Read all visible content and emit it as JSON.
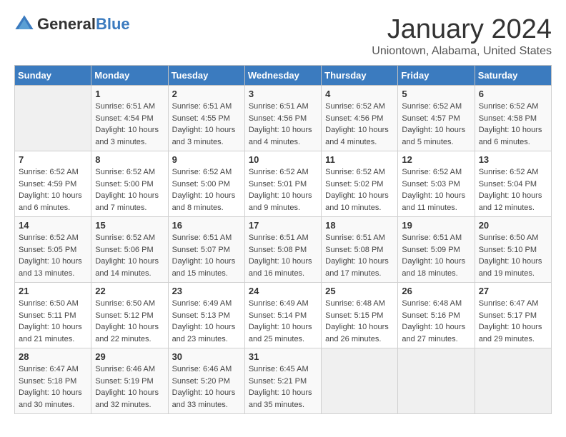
{
  "logo": {
    "general": "General",
    "blue": "Blue"
  },
  "header": {
    "month": "January 2024",
    "location": "Uniontown, Alabama, United States"
  },
  "weekdays": [
    "Sunday",
    "Monday",
    "Tuesday",
    "Wednesday",
    "Thursday",
    "Friday",
    "Saturday"
  ],
  "weeks": [
    [
      {
        "day": "",
        "sunrise": "",
        "sunset": "",
        "daylight": ""
      },
      {
        "day": "1",
        "sunrise": "6:51 AM",
        "sunset": "4:54 PM",
        "daylight": "10 hours and 3 minutes."
      },
      {
        "day": "2",
        "sunrise": "6:51 AM",
        "sunset": "4:55 PM",
        "daylight": "10 hours and 3 minutes."
      },
      {
        "day": "3",
        "sunrise": "6:51 AM",
        "sunset": "4:56 PM",
        "daylight": "10 hours and 4 minutes."
      },
      {
        "day": "4",
        "sunrise": "6:52 AM",
        "sunset": "4:56 PM",
        "daylight": "10 hours and 4 minutes."
      },
      {
        "day": "5",
        "sunrise": "6:52 AM",
        "sunset": "4:57 PM",
        "daylight": "10 hours and 5 minutes."
      },
      {
        "day": "6",
        "sunrise": "6:52 AM",
        "sunset": "4:58 PM",
        "daylight": "10 hours and 6 minutes."
      }
    ],
    [
      {
        "day": "7",
        "sunrise": "6:52 AM",
        "sunset": "4:59 PM",
        "daylight": "10 hours and 6 minutes."
      },
      {
        "day": "8",
        "sunrise": "6:52 AM",
        "sunset": "5:00 PM",
        "daylight": "10 hours and 7 minutes."
      },
      {
        "day": "9",
        "sunrise": "6:52 AM",
        "sunset": "5:00 PM",
        "daylight": "10 hours and 8 minutes."
      },
      {
        "day": "10",
        "sunrise": "6:52 AM",
        "sunset": "5:01 PM",
        "daylight": "10 hours and 9 minutes."
      },
      {
        "day": "11",
        "sunrise": "6:52 AM",
        "sunset": "5:02 PM",
        "daylight": "10 hours and 10 minutes."
      },
      {
        "day": "12",
        "sunrise": "6:52 AM",
        "sunset": "5:03 PM",
        "daylight": "10 hours and 11 minutes."
      },
      {
        "day": "13",
        "sunrise": "6:52 AM",
        "sunset": "5:04 PM",
        "daylight": "10 hours and 12 minutes."
      }
    ],
    [
      {
        "day": "14",
        "sunrise": "6:52 AM",
        "sunset": "5:05 PM",
        "daylight": "10 hours and 13 minutes."
      },
      {
        "day": "15",
        "sunrise": "6:52 AM",
        "sunset": "5:06 PM",
        "daylight": "10 hours and 14 minutes."
      },
      {
        "day": "16",
        "sunrise": "6:51 AM",
        "sunset": "5:07 PM",
        "daylight": "10 hours and 15 minutes."
      },
      {
        "day": "17",
        "sunrise": "6:51 AM",
        "sunset": "5:08 PM",
        "daylight": "10 hours and 16 minutes."
      },
      {
        "day": "18",
        "sunrise": "6:51 AM",
        "sunset": "5:08 PM",
        "daylight": "10 hours and 17 minutes."
      },
      {
        "day": "19",
        "sunrise": "6:51 AM",
        "sunset": "5:09 PM",
        "daylight": "10 hours and 18 minutes."
      },
      {
        "day": "20",
        "sunrise": "6:50 AM",
        "sunset": "5:10 PM",
        "daylight": "10 hours and 19 minutes."
      }
    ],
    [
      {
        "day": "21",
        "sunrise": "6:50 AM",
        "sunset": "5:11 PM",
        "daylight": "10 hours and 21 minutes."
      },
      {
        "day": "22",
        "sunrise": "6:50 AM",
        "sunset": "5:12 PM",
        "daylight": "10 hours and 22 minutes."
      },
      {
        "day": "23",
        "sunrise": "6:49 AM",
        "sunset": "5:13 PM",
        "daylight": "10 hours and 23 minutes."
      },
      {
        "day": "24",
        "sunrise": "6:49 AM",
        "sunset": "5:14 PM",
        "daylight": "10 hours and 25 minutes."
      },
      {
        "day": "25",
        "sunrise": "6:48 AM",
        "sunset": "5:15 PM",
        "daylight": "10 hours and 26 minutes."
      },
      {
        "day": "26",
        "sunrise": "6:48 AM",
        "sunset": "5:16 PM",
        "daylight": "10 hours and 27 minutes."
      },
      {
        "day": "27",
        "sunrise": "6:47 AM",
        "sunset": "5:17 PM",
        "daylight": "10 hours and 29 minutes."
      }
    ],
    [
      {
        "day": "28",
        "sunrise": "6:47 AM",
        "sunset": "5:18 PM",
        "daylight": "10 hours and 30 minutes."
      },
      {
        "day": "29",
        "sunrise": "6:46 AM",
        "sunset": "5:19 PM",
        "daylight": "10 hours and 32 minutes."
      },
      {
        "day": "30",
        "sunrise": "6:46 AM",
        "sunset": "5:20 PM",
        "daylight": "10 hours and 33 minutes."
      },
      {
        "day": "31",
        "sunrise": "6:45 AM",
        "sunset": "5:21 PM",
        "daylight": "10 hours and 35 minutes."
      },
      {
        "day": "",
        "sunrise": "",
        "sunset": "",
        "daylight": ""
      },
      {
        "day": "",
        "sunrise": "",
        "sunset": "",
        "daylight": ""
      },
      {
        "day": "",
        "sunrise": "",
        "sunset": "",
        "daylight": ""
      }
    ]
  ],
  "labels": {
    "sunrise_prefix": "Sunrise: ",
    "sunset_prefix": "Sunset: ",
    "daylight_prefix": "Daylight: "
  }
}
